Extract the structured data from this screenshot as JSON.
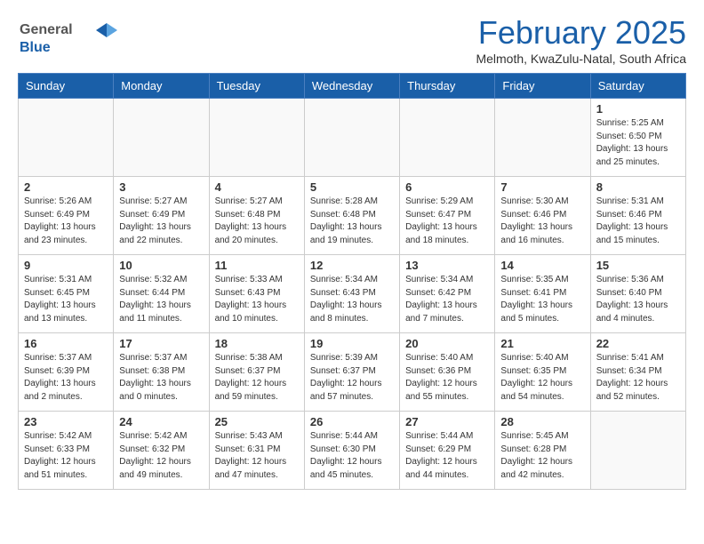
{
  "logo": {
    "general": "General",
    "blue": "Blue"
  },
  "header": {
    "month_year": "February 2025",
    "location": "Melmoth, KwaZulu-Natal, South Africa"
  },
  "weekdays": [
    "Sunday",
    "Monday",
    "Tuesday",
    "Wednesday",
    "Thursday",
    "Friday",
    "Saturday"
  ],
  "weeks": [
    [
      {
        "day": "",
        "info": ""
      },
      {
        "day": "",
        "info": ""
      },
      {
        "day": "",
        "info": ""
      },
      {
        "day": "",
        "info": ""
      },
      {
        "day": "",
        "info": ""
      },
      {
        "day": "",
        "info": ""
      },
      {
        "day": "1",
        "info": "Sunrise: 5:25 AM\nSunset: 6:50 PM\nDaylight: 13 hours\nand 25 minutes."
      }
    ],
    [
      {
        "day": "2",
        "info": "Sunrise: 5:26 AM\nSunset: 6:49 PM\nDaylight: 13 hours\nand 23 minutes."
      },
      {
        "day": "3",
        "info": "Sunrise: 5:27 AM\nSunset: 6:49 PM\nDaylight: 13 hours\nand 22 minutes."
      },
      {
        "day": "4",
        "info": "Sunrise: 5:27 AM\nSunset: 6:48 PM\nDaylight: 13 hours\nand 20 minutes."
      },
      {
        "day": "5",
        "info": "Sunrise: 5:28 AM\nSunset: 6:48 PM\nDaylight: 13 hours\nand 19 minutes."
      },
      {
        "day": "6",
        "info": "Sunrise: 5:29 AM\nSunset: 6:47 PM\nDaylight: 13 hours\nand 18 minutes."
      },
      {
        "day": "7",
        "info": "Sunrise: 5:30 AM\nSunset: 6:46 PM\nDaylight: 13 hours\nand 16 minutes."
      },
      {
        "day": "8",
        "info": "Sunrise: 5:31 AM\nSunset: 6:46 PM\nDaylight: 13 hours\nand 15 minutes."
      }
    ],
    [
      {
        "day": "9",
        "info": "Sunrise: 5:31 AM\nSunset: 6:45 PM\nDaylight: 13 hours\nand 13 minutes."
      },
      {
        "day": "10",
        "info": "Sunrise: 5:32 AM\nSunset: 6:44 PM\nDaylight: 13 hours\nand 11 minutes."
      },
      {
        "day": "11",
        "info": "Sunrise: 5:33 AM\nSunset: 6:43 PM\nDaylight: 13 hours\nand 10 minutes."
      },
      {
        "day": "12",
        "info": "Sunrise: 5:34 AM\nSunset: 6:43 PM\nDaylight: 13 hours\nand 8 minutes."
      },
      {
        "day": "13",
        "info": "Sunrise: 5:34 AM\nSunset: 6:42 PM\nDaylight: 13 hours\nand 7 minutes."
      },
      {
        "day": "14",
        "info": "Sunrise: 5:35 AM\nSunset: 6:41 PM\nDaylight: 13 hours\nand 5 minutes."
      },
      {
        "day": "15",
        "info": "Sunrise: 5:36 AM\nSunset: 6:40 PM\nDaylight: 13 hours\nand 4 minutes."
      }
    ],
    [
      {
        "day": "16",
        "info": "Sunrise: 5:37 AM\nSunset: 6:39 PM\nDaylight: 13 hours\nand 2 minutes."
      },
      {
        "day": "17",
        "info": "Sunrise: 5:37 AM\nSunset: 6:38 PM\nDaylight: 13 hours\nand 0 minutes."
      },
      {
        "day": "18",
        "info": "Sunrise: 5:38 AM\nSunset: 6:37 PM\nDaylight: 12 hours\nand 59 minutes."
      },
      {
        "day": "19",
        "info": "Sunrise: 5:39 AM\nSunset: 6:37 PM\nDaylight: 12 hours\nand 57 minutes."
      },
      {
        "day": "20",
        "info": "Sunrise: 5:40 AM\nSunset: 6:36 PM\nDaylight: 12 hours\nand 55 minutes."
      },
      {
        "day": "21",
        "info": "Sunrise: 5:40 AM\nSunset: 6:35 PM\nDaylight: 12 hours\nand 54 minutes."
      },
      {
        "day": "22",
        "info": "Sunrise: 5:41 AM\nSunset: 6:34 PM\nDaylight: 12 hours\nand 52 minutes."
      }
    ],
    [
      {
        "day": "23",
        "info": "Sunrise: 5:42 AM\nSunset: 6:33 PM\nDaylight: 12 hours\nand 51 minutes."
      },
      {
        "day": "24",
        "info": "Sunrise: 5:42 AM\nSunset: 6:32 PM\nDaylight: 12 hours\nand 49 minutes."
      },
      {
        "day": "25",
        "info": "Sunrise: 5:43 AM\nSunset: 6:31 PM\nDaylight: 12 hours\nand 47 minutes."
      },
      {
        "day": "26",
        "info": "Sunrise: 5:44 AM\nSunset: 6:30 PM\nDaylight: 12 hours\nand 45 minutes."
      },
      {
        "day": "27",
        "info": "Sunrise: 5:44 AM\nSunset: 6:29 PM\nDaylight: 12 hours\nand 44 minutes."
      },
      {
        "day": "28",
        "info": "Sunrise: 5:45 AM\nSunset: 6:28 PM\nDaylight: 12 hours\nand 42 minutes."
      },
      {
        "day": "",
        "info": ""
      }
    ]
  ]
}
